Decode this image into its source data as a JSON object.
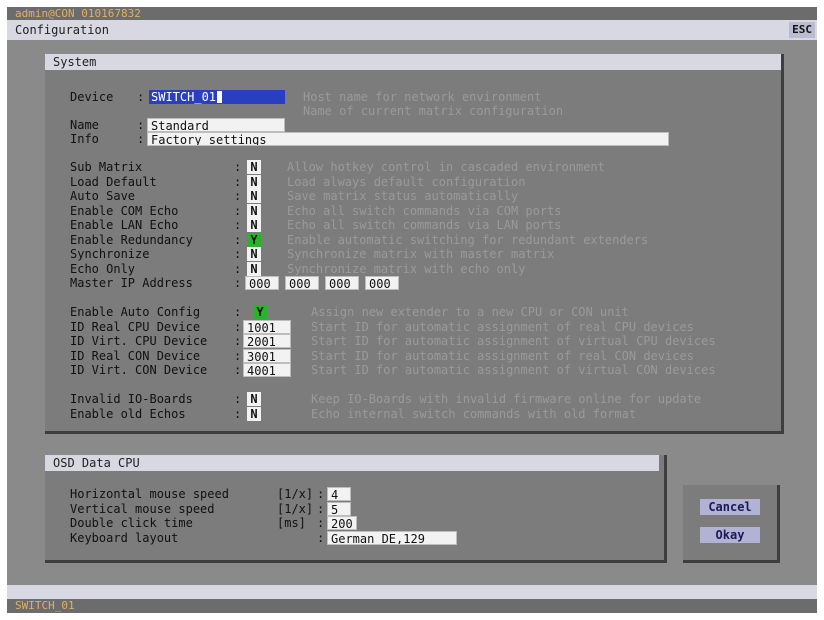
{
  "top_bar": {
    "user": "admin@CON 010167832"
  },
  "title_bar": {
    "title": "Configuration",
    "esc_label": "ESC"
  },
  "system": {
    "title": "System",
    "device_label": "Device",
    "device_value": "SWITCH_01",
    "device_hint_1": "Host name for network environment",
    "device_hint_2": "Name of current matrix configuration",
    "name_label": "Name",
    "name_value": "Standard",
    "info_label": "Info",
    "info_value": "Factory settings",
    "flags": [
      {
        "label": "Sub Matrix",
        "value": "N",
        "hint": "Allow hotkey control in cascaded environment"
      },
      {
        "label": "Load Default",
        "value": "N",
        "hint": "Load always default configuration"
      },
      {
        "label": "Auto Save",
        "value": "N",
        "hint": "Save matrix status automatically"
      },
      {
        "label": "Enable COM Echo",
        "value": "N",
        "hint": "Echo all switch commands via COM ports"
      },
      {
        "label": "Enable LAN Echo",
        "value": "N",
        "hint": "Echo all switch commands via LAN ports"
      },
      {
        "label": "Enable Redundancy",
        "value": "Y",
        "hint": "Enable automatic switching for redundant extenders"
      },
      {
        "label": "Synchronize",
        "value": "N",
        "hint": "Synchronize matrix with master matrix"
      },
      {
        "label": "Echo Only",
        "value": "N",
        "hint": "Synchronize matrix with echo only"
      }
    ],
    "master_ip": {
      "label": "Master IP Address",
      "octets": [
        "000",
        "000",
        "000",
        "000"
      ]
    },
    "auto_config": [
      {
        "label": "Enable Auto Config",
        "value": "Y",
        "hint": "Assign new extender to a new CPU or CON unit"
      },
      {
        "label": "ID Real CPU Device",
        "value": "1001",
        "hint": "Start ID for automatic assignment of real CPU devices"
      },
      {
        "label": "ID Virt. CPU Device",
        "value": "2001",
        "hint": "Start ID for automatic assignment of virtual CPU devices"
      },
      {
        "label": "ID Real CON Device",
        "value": "3001",
        "hint": "Start ID for automatic assignment of real CON devices"
      },
      {
        "label": "ID Virt. CON Device",
        "value": "4001",
        "hint": "Start ID for automatic assignment of virtual CON devices"
      }
    ],
    "legacy": [
      {
        "label": "Invalid IO-Boards",
        "value": "N",
        "hint": "Keep IO-Boards with invalid firmware online for update"
      },
      {
        "label": "Enable old Echos",
        "value": "N",
        "hint": "Echo internal switch commands with old format"
      }
    ]
  },
  "osd": {
    "title": "OSD Data CPU",
    "rows": [
      {
        "label": "Horizontal mouse speed",
        "unit": "[1/x]",
        "value": "4"
      },
      {
        "label": "Vertical mouse speed",
        "unit": "[1/x]",
        "value": "5"
      },
      {
        "label": "Double click time",
        "unit": "[ms]",
        "value": "200"
      },
      {
        "label": "Keyboard layout",
        "unit": "",
        "value": "German DE,129"
      }
    ]
  },
  "buttons": {
    "cancel": "Cancel",
    "okay": "Okay"
  },
  "status_bar": {
    "text": "SWITCH_01"
  }
}
